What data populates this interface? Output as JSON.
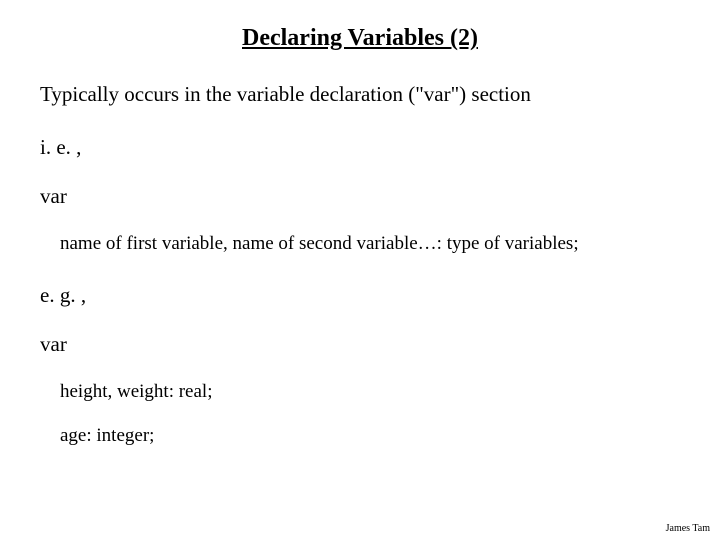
{
  "title": "Declaring Variables (2)",
  "intro": "Typically occurs in the variable declaration (\"var\") section",
  "abbrev1": "i. e. ,",
  "keyword1": "var",
  "syntax_line": "name of first variable, name of second variable…: type of variables;",
  "abbrev2": "e. g. ,",
  "keyword2": "var",
  "example_line1": "height, weight: real;",
  "example_line2": "age: integer;",
  "footer": "James Tam"
}
